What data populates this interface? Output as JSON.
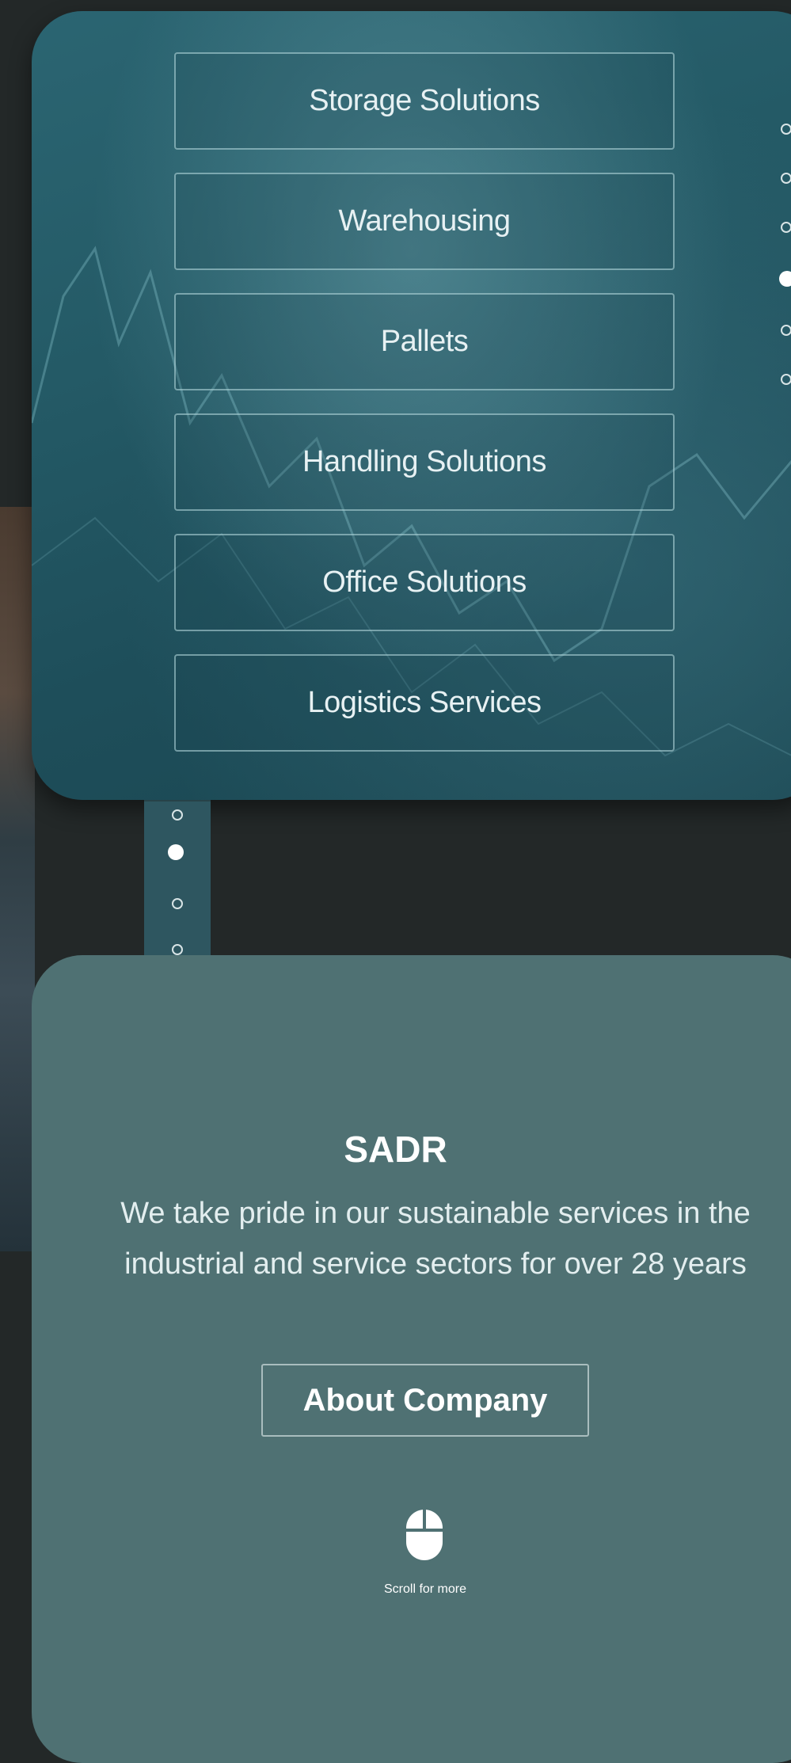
{
  "services_menu": {
    "items": [
      {
        "label": "Storage Solutions"
      },
      {
        "label": "Warehousing"
      },
      {
        "label": "Pallets"
      },
      {
        "label": "Handling Solutions"
      },
      {
        "label": "Office Solutions"
      },
      {
        "label": "Logistics Services"
      }
    ]
  },
  "pagination_right": {
    "count": 6,
    "active_index": 3
  },
  "pagination_mid": {
    "count": 4,
    "active_index": 1
  },
  "about": {
    "title": "SADR",
    "description": "We take pride in our sustainable services in the industrial and service sectors for over 28 years",
    "button_label": "About Company",
    "scroll_hint": "Scroll for more",
    "scroll_icon": "mouse-icon"
  },
  "colors": {
    "page_background": "#232828",
    "menu_card": "#245a66",
    "about_card": "#4f7173",
    "text_light": "#ffffff"
  }
}
